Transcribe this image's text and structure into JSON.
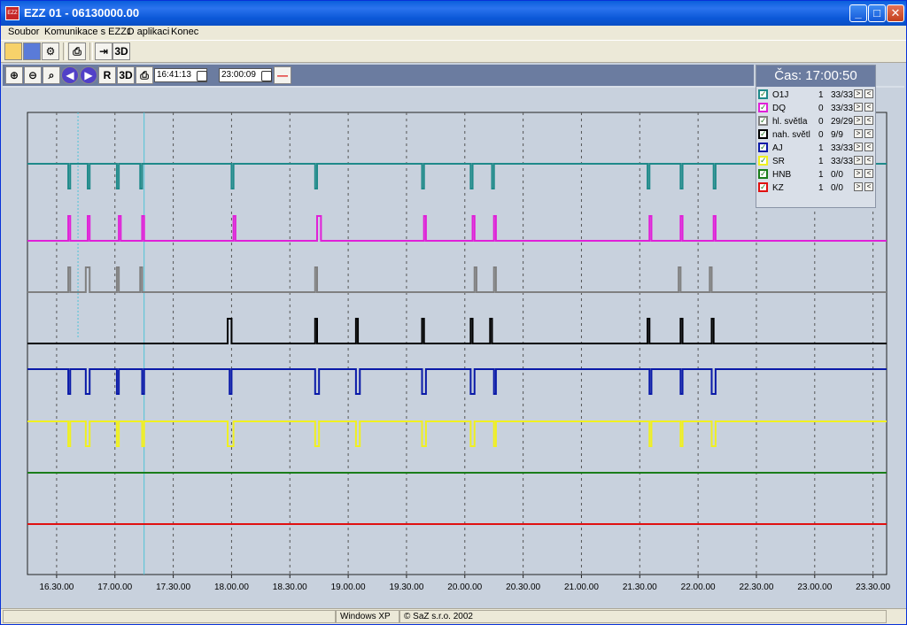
{
  "window": {
    "title": "EZZ 01 - 06130000.00",
    "icon_text": "EZZ"
  },
  "menu": [
    "Soubor",
    "Komunikace s EZZ1",
    "O aplikaci",
    "Konec"
  ],
  "toolbar": {
    "three_d_label": "3D",
    "r_label": "R"
  },
  "times": {
    "start": "16:41:13",
    "end": "23:00:09"
  },
  "legend": {
    "header": "Čas: 17:00:50",
    "rows": [
      {
        "name": "O1J",
        "value": "1",
        "count": "33/33",
        "color": "#1f8a8a"
      },
      {
        "name": "DQ",
        "value": "0",
        "count": "33/33",
        "color": "#e020d8"
      },
      {
        "name": "hl. světla",
        "value": "0",
        "count": "29/29",
        "color": "#808080"
      },
      {
        "name": "nah. světl",
        "value": "0",
        "count": "9/9",
        "color": "#000000"
      },
      {
        "name": "AJ",
        "value": "1",
        "count": "33/33",
        "color": "#0a1aa8"
      },
      {
        "name": "SR",
        "value": "1",
        "count": "33/33",
        "color": "#f0f020"
      },
      {
        "name": "HNB",
        "value": "1",
        "count": "0/0",
        "color": "#1a7d1a"
      },
      {
        "name": "KZ",
        "value": "1",
        "count": "0/0",
        "color": "#e01010"
      }
    ]
  },
  "chart_data": {
    "type": "line",
    "x_ticks": [
      "16.30.00",
      "17.00.00",
      "17.30.00",
      "18.00.00",
      "18.30.00",
      "19.00.00",
      "19.30.00",
      "20.00.00",
      "20.30.00",
      "21.00.00",
      "21.30.00",
      "22.00.00",
      "22.30.00",
      "23.00.00",
      "23.30.00"
    ],
    "xlim_minutes": [
      975,
      1417
    ],
    "cursor_minutes": [
      1001,
      1035
    ],
    "series": [
      {
        "name": "O1J",
        "color": "#1f8a8a",
        "baseline": "high",
        "pulses": [
          [
            996,
            997
          ],
          [
            1006,
            1007
          ],
          [
            1021,
            1022
          ],
          [
            1033,
            1034
          ],
          [
            1080,
            1081
          ],
          [
            1123,
            1124
          ],
          [
            1178,
            1179
          ],
          [
            1203,
            1204
          ],
          [
            1214,
            1215
          ],
          [
            1294,
            1295
          ],
          [
            1311,
            1312
          ],
          [
            1328,
            1329
          ]
        ]
      },
      {
        "name": "DQ",
        "color": "#e020d8",
        "baseline": "low",
        "pulses": [
          [
            996,
            997
          ],
          [
            1006,
            1007
          ],
          [
            1022,
            1023
          ],
          [
            1034,
            1035
          ],
          [
            1081,
            1082
          ],
          [
            1124,
            1126
          ],
          [
            1179,
            1180
          ],
          [
            1204,
            1205
          ],
          [
            1215,
            1216
          ],
          [
            1295,
            1296
          ],
          [
            1311,
            1312
          ],
          [
            1328,
            1329
          ]
        ]
      },
      {
        "name": "hl. světla",
        "color": "#808080",
        "baseline": "low",
        "pulses": [
          [
            996,
            997
          ],
          [
            1005,
            1007
          ],
          [
            1021,
            1022
          ],
          [
            1033,
            1034
          ],
          [
            1123,
            1124
          ],
          [
            1205,
            1206
          ],
          [
            1215,
            1216
          ],
          [
            1310,
            1311
          ],
          [
            1326,
            1327
          ]
        ]
      },
      {
        "name": "nah. světl",
        "color": "#000000",
        "baseline": "low",
        "pulses": [
          [
            1078,
            1080
          ],
          [
            1123,
            1124
          ],
          [
            1144,
            1145
          ],
          [
            1178,
            1179
          ],
          [
            1203,
            1204
          ],
          [
            1213,
            1214
          ],
          [
            1294,
            1295
          ],
          [
            1311,
            1312
          ],
          [
            1327,
            1328
          ]
        ]
      },
      {
        "name": "AJ",
        "color": "#0a1aa8",
        "baseline": "high",
        "pulses": [
          [
            996,
            997
          ],
          [
            1005,
            1007
          ],
          [
            1021,
            1022
          ],
          [
            1034,
            1035
          ],
          [
            1079,
            1080
          ],
          [
            1123,
            1125
          ],
          [
            1144,
            1146
          ],
          [
            1178,
            1180
          ],
          [
            1203,
            1205
          ],
          [
            1215,
            1216
          ],
          [
            1295,
            1296
          ],
          [
            1311,
            1312
          ],
          [
            1327,
            1329
          ]
        ]
      },
      {
        "name": "SR",
        "color": "#f0f020",
        "baseline": "high",
        "pulses": [
          [
            996,
            997
          ],
          [
            1005,
            1007
          ],
          [
            1021,
            1022
          ],
          [
            1034,
            1035
          ],
          [
            1078,
            1081
          ],
          [
            1123,
            1125
          ],
          [
            1144,
            1146
          ],
          [
            1178,
            1180
          ],
          [
            1203,
            1205
          ],
          [
            1215,
            1216
          ],
          [
            1295,
            1296
          ],
          [
            1311,
            1312
          ],
          [
            1327,
            1329
          ]
        ]
      },
      {
        "name": "HNB",
        "color": "#1a7d1a",
        "baseline": "flat",
        "pulses": []
      },
      {
        "name": "KZ",
        "color": "#e01010",
        "baseline": "flat",
        "pulses": []
      }
    ]
  },
  "status": {
    "os": "Windows XP",
    "copyright": "© SaZ s.r.o. 2002"
  }
}
